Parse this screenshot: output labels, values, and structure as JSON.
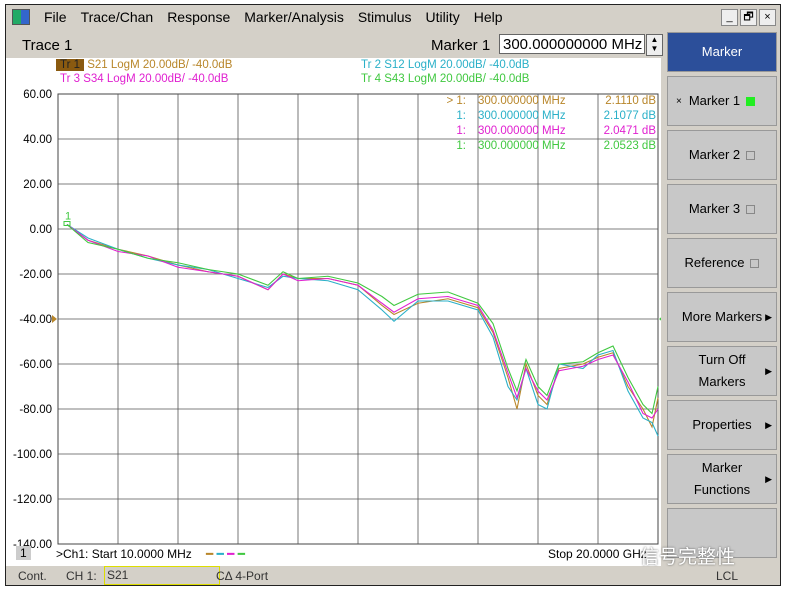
{
  "menu": [
    "File",
    "Trace/Chan",
    "Response",
    "Marker/Analysis",
    "Stimulus",
    "Utility",
    "Help"
  ],
  "window_controls": [
    "_",
    "🗗",
    "×"
  ],
  "trace_title": "Trace 1",
  "marker_label": "Marker 1",
  "marker_value": "300.000000000 MHz",
  "traces": [
    {
      "id": "Tr 1",
      "label": "S21 LogM 20.00dB/  -40.0dB",
      "color": "#b8862a",
      "active": true
    },
    {
      "id": "Tr 2",
      "label": "S12 LogM 20.00dB/  -40.0dB",
      "color": "#2ab0c8"
    },
    {
      "id": "Tr 3",
      "label": "S34 LogM 20.00dB/  -40.0dB",
      "color": "#e020d0"
    },
    {
      "id": "Tr 4",
      "label": "S43 LogM 20.00dB/  -40.0dB",
      "color": "#40c840"
    }
  ],
  "marker_readouts": [
    {
      "num": "> 1:",
      "freq": "300.000000 MHz",
      "val": "2.1110 dB"
    },
    {
      "num": "1:",
      "freq": "300.000000 MHz",
      "val": "2.1077 dB"
    },
    {
      "num": "1:",
      "freq": "300.000000 MHz",
      "val": "2.0471 dB"
    },
    {
      "num": "1:",
      "freq": "300.000000 MHz",
      "val": "2.0523 dB"
    }
  ],
  "marker_tag": "1",
  "y_ticks": [
    "60.00",
    "40.00",
    "20.00",
    "0.00",
    "-20.00",
    "-40.00",
    "-60.00",
    "-80.00",
    "-100.00",
    "-120.00",
    "-140.00"
  ],
  "channel_num": "1",
  "start_label": ">Ch1: Start  10.0000 MHz",
  "stop_label": "Stop  20.0000 GHz",
  "watermark": "信号完整性",
  "softkeys": [
    {
      "label": "Marker",
      "title": true
    },
    {
      "label": "Marker 1",
      "star": "×",
      "indicator": "on"
    },
    {
      "label": "Marker 2",
      "indicator": "off"
    },
    {
      "label": "Marker 3",
      "indicator": "off"
    },
    {
      "label": "Reference",
      "indicator": "off"
    },
    {
      "label": "More Markers",
      "arrow": true
    },
    {
      "label": "Turn Off\nMarkers",
      "arrow": true
    },
    {
      "label": "Properties",
      "arrow": true
    },
    {
      "label": "Marker\nFunctions",
      "arrow": true
    },
    {
      "label": ""
    }
  ],
  "status": {
    "mode": "Cont.",
    "channel": "CH 1:",
    "param": "S21",
    "cal": "CΔ 4-Port",
    "lcl": "LCL"
  },
  "chart_data": {
    "type": "line",
    "xlim_ghz": [
      0.01,
      20
    ],
    "ylim": [
      -140,
      60
    ],
    "grid": true,
    "series": [
      {
        "trace": "Tr 1",
        "x": [
          0.3,
          1,
          2,
          3,
          4,
          5,
          6,
          7,
          7.5,
          8,
          9,
          10,
          10.8,
          11.2,
          12,
          13,
          14,
          14.5,
          15,
          15.3,
          15.6,
          16,
          16.3,
          16.7,
          17.5,
          18,
          18.5,
          19,
          19.5,
          19.8,
          20
        ],
        "y": [
          2,
          -5,
          -9,
          -12,
          -16,
          -19,
          -21,
          -27,
          -20,
          -22,
          -22,
          -25,
          -34,
          -38,
          -33,
          -31,
          -35,
          -46,
          -66,
          -80,
          -60,
          -74,
          -78,
          -62,
          -60,
          -57,
          -55,
          -70,
          -80,
          -88,
          -75
        ]
      },
      {
        "trace": "Tr 2",
        "x": [
          0.3,
          1,
          2,
          3,
          4,
          5,
          6,
          7,
          7.5,
          8,
          9,
          10,
          10.8,
          11.2,
          12,
          13,
          14,
          14.5,
          15,
          15.3,
          15.6,
          16,
          16.3,
          16.7,
          17.5,
          18,
          18.5,
          19,
          19.5,
          19.8,
          20
        ],
        "y": [
          2,
          -4,
          -9,
          -13,
          -16,
          -18,
          -22,
          -26,
          -21,
          -22,
          -23,
          -27,
          -36,
          -41,
          -32,
          -32,
          -36,
          -48,
          -70,
          -76,
          -62,
          -78,
          -80,
          -60,
          -62,
          -56,
          -54,
          -72,
          -84,
          -86,
          -92
        ]
      },
      {
        "trace": "Tr 3",
        "x": [
          0.3,
          1,
          2,
          3,
          4,
          5,
          6,
          7,
          7.5,
          8,
          9,
          10,
          10.8,
          11.2,
          12,
          13,
          14,
          14.5,
          15,
          15.3,
          15.6,
          16,
          16.3,
          16.7,
          17.5,
          18,
          18.5,
          19,
          19.5,
          19.8,
          20
        ],
        "y": [
          2,
          -5,
          -10,
          -12,
          -17,
          -19,
          -21,
          -27,
          -20,
          -23,
          -22,
          -25,
          -33,
          -37,
          -31,
          -30,
          -34,
          -45,
          -64,
          -75,
          -62,
          -72,
          -76,
          -63,
          -61,
          -58,
          -56,
          -68,
          -82,
          -84,
          -80
        ]
      },
      {
        "trace": "Tr 4",
        "x": [
          0.3,
          1,
          2,
          3,
          4,
          5,
          6,
          7,
          7.5,
          8,
          9,
          10,
          10.8,
          11.2,
          12,
          13,
          14,
          14.5,
          15,
          15.3,
          15.6,
          16,
          16.3,
          16.7,
          17.5,
          18,
          18.5,
          19,
          19.5,
          19.8,
          20
        ],
        "y": [
          2,
          -6,
          -9,
          -13,
          -15,
          -18,
          -20,
          -25,
          -19,
          -22,
          -21,
          -24,
          -30,
          -34,
          -29,
          -28,
          -33,
          -42,
          -62,
          -72,
          -58,
          -70,
          -74,
          -60,
          -59,
          -55,
          -52,
          -66,
          -78,
          -82,
          -70
        ]
      }
    ]
  }
}
